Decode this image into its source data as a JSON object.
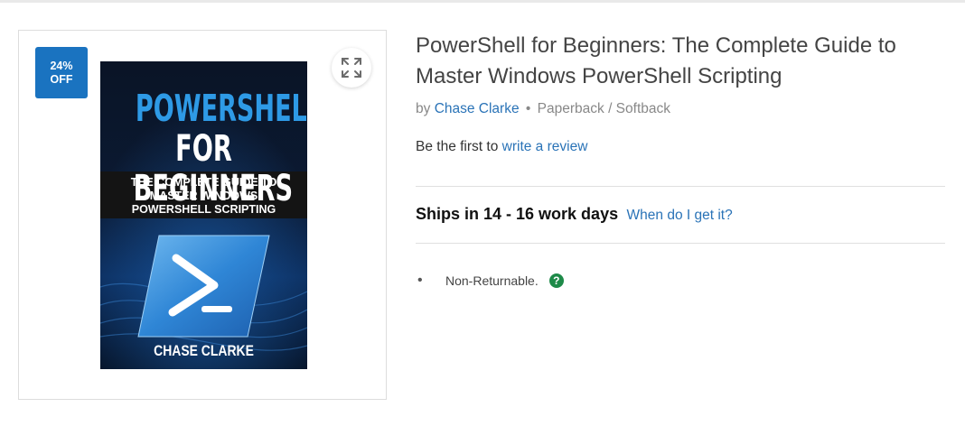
{
  "badge": {
    "line1": "24%",
    "line2": "OFF"
  },
  "cover": {
    "title_line1": "POWERSHELL",
    "title_line2": "FOR BEGINNERS",
    "subtitle_1": "THE COMPLETE GUIDE TO",
    "subtitle_2": "MASTER WINDOWS",
    "subtitle_3": "POWERSHELL SCRIPTING",
    "author": "CHASE CLARKE"
  },
  "product": {
    "title_line1": "PowerShell for Beginners: The Complete Guide to",
    "title_line2": "Master Windows PowerShell Scripting",
    "by_label": "by",
    "author": "Chase Clarke",
    "separator": "•",
    "format": "Paperback / Softback"
  },
  "review": {
    "prefix": "Be the first to",
    "link": "write a review"
  },
  "shipping": {
    "text": "Ships in 14 - 16 work days",
    "link": "When do I get it?"
  },
  "policies": {
    "bullet": "•",
    "text": "Non-Returnable.",
    "help_icon": "?"
  },
  "icons": {
    "expand": "expand-icon",
    "help": "help-icon"
  },
  "colors": {
    "badge": "#1a73c0",
    "link": "#2a73b7",
    "help": "#1e8a49"
  }
}
